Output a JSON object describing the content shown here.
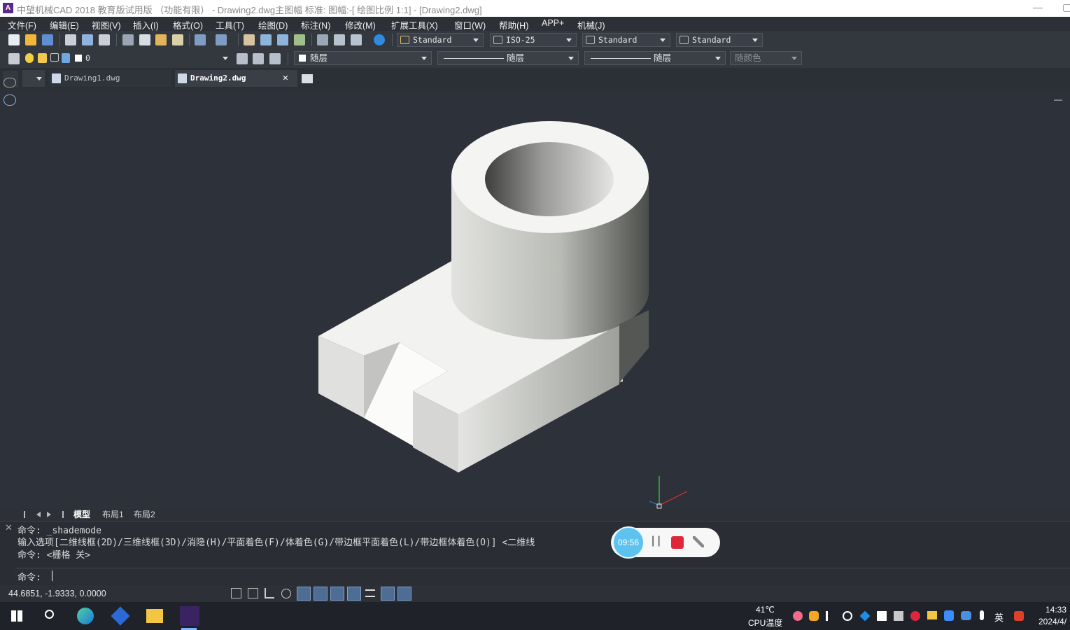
{
  "window": {
    "title": "中望机械CAD 2018 教育版试用版 （功能有限） - Drawing2.dwg主图幅  标准: 图幅:-[ 绘图比例 1:1] - [Drawing2.dwg]",
    "app_icon_glyph": "A",
    "minimize": "—",
    "restore": "▢"
  },
  "menu": [
    "文件(F)",
    "编辑(E)",
    "视图(V)",
    "插入(I)",
    "格式(O)",
    "工具(T)",
    "绘图(D)",
    "标注(N)",
    "修改(M)",
    "扩展工具(X)",
    "窗口(W)",
    "帮助(H)",
    "APP+",
    "机械(J)"
  ],
  "toolbar": {
    "text_style": "Standard",
    "dim_style": "ISO-25",
    "table_style": "Standard",
    "mleader_style": "Standard",
    "layer": "0",
    "color": "随层",
    "linetype": "随层",
    "lineweight": "随层",
    "plot_style": "随颜色"
  },
  "tabs": [
    {
      "label": "Drawing1.dwg",
      "active": false
    },
    {
      "label": "Drawing2.dwg",
      "active": true
    }
  ],
  "tab_close": "✕",
  "viewport_corner": "—",
  "layout_tabs": [
    "模型",
    "布局1",
    "布局2"
  ],
  "command": {
    "history": [
      "命令: _shademode",
      "输入选项[二维线框(2D)/三维线框(3D)/消隐(H)/平面着色(F)/体着色(G)/带边框平面着色(L)/带边框体着色(O)] <二维线",
      "命令: <栅格 关>"
    ],
    "prompt": "命令:",
    "close": "✕"
  },
  "status": {
    "coordinates": "44.6851, -1.9333, 0.0000"
  },
  "recorder": {
    "timer": "09:56",
    "pause": "| |"
  },
  "taskbar": {
    "temperature": "41℃",
    "temp_label": "CPU温度",
    "ime": "英",
    "time": "14:33",
    "date": "2024/4/"
  },
  "colors": {
    "viewport_bg": "#2d3139",
    "accent": "#5b2a86",
    "record_red": "#e0263a"
  }
}
